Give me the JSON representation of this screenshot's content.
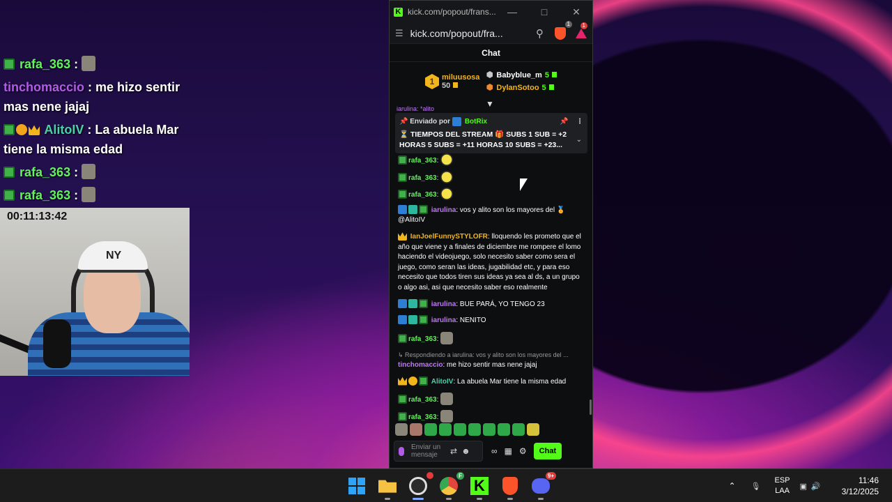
{
  "overlay_chat": [
    {
      "user": "rafa_363",
      "text": ":",
      "badges": [
        "green"
      ],
      "emote": true,
      "user_color": "green"
    },
    {
      "user": "tinchomaccio",
      "text": ": me hizo sentir mas nene jajaj",
      "badges": [],
      "emote": false,
      "user_color": "purple"
    },
    {
      "user": "AlitoIV",
      "text": ": La abuela Mar tiene la misma edad",
      "badges": [
        "green",
        "coin",
        "crown"
      ],
      "emote": false,
      "user_color": "teal"
    },
    {
      "user": "rafa_363",
      "text": ":",
      "badges": [
        "green"
      ],
      "emote": true,
      "user_color": "green"
    },
    {
      "user": "rafa_363",
      "text": ":",
      "badges": [
        "green"
      ],
      "emote": true,
      "user_color": "green"
    }
  ],
  "webcam": {
    "timer": "00:11:13:42",
    "cap_text": "NY"
  },
  "browser": {
    "title": "kick.com/popout/frans...",
    "url": "kick.com/popout/fra...",
    "brave_badge": "1",
    "alert_badge": "1",
    "logo_letter": "K"
  },
  "chat": {
    "header": "Chat",
    "leaderboard": {
      "first": {
        "rank": "1",
        "name": "miluusosa",
        "count": "50"
      },
      "others": [
        {
          "name": "Babyblue_m",
          "count": "5"
        },
        {
          "name": "DylanSotoo",
          "count": "5"
        }
      ]
    },
    "pinned": {
      "prefix": "Enviado por",
      "author": "BotRix",
      "text": "⏳ TIEMPOS DEL STREAM 🎁 SUBS 1 SUB = +2 HORAS 5 SUBS = +11 HORAS 10 SUBS = +23..."
    },
    "partial_top": "iarulina: *alito",
    "messages": [
      {
        "user": "rafa_363",
        "text": "",
        "emote": "yellow",
        "color": "green"
      },
      {
        "user": "rafa_363",
        "text": "",
        "emote": "yellow",
        "color": "green"
      },
      {
        "user": "rafa_363",
        "text": "",
        "emote": "yellow",
        "color": "green"
      },
      {
        "user": "iarulina",
        "text": "vos y alito son los mayores del 🏅 @AlitoIV",
        "color": "purple"
      },
      {
        "user": "IanJoelFunnySTYLOFR",
        "text": "lloquendo les prometo que el año que viene y a finales de diciembre me rompere el lomo haciendo el videojuego, solo necesito saber como sera el juego, como seran las ideas, jugabilidad etc, y para eso necesito que todos tiren sus ideas ya sea al ds, a un grupo o algo asi, asi que necesito saber eso realmente",
        "color": "orange"
      },
      {
        "user": "iarulina",
        "text": "BUE PARÁ, YO TENGO 23",
        "color": "purple"
      },
      {
        "user": "iarulina",
        "text": "NENITO",
        "color": "purple"
      },
      {
        "user": "rafa_363",
        "text": "",
        "emote": "cat",
        "color": "green"
      },
      {
        "reply": "↳ Respondiendo a iarulina: vos y alito son los mayores del ...",
        "user": "tinchomaccio",
        "text": "me hizo sentir mas nene jajaj",
        "color": "purple"
      },
      {
        "user": "AlitoIV",
        "text": "La abuela Mar tiene la misma edad",
        "color": "teal"
      },
      {
        "user": "rafa_363",
        "text": "",
        "emote": "cat",
        "color": "green"
      },
      {
        "user": "rafa_363",
        "text": "",
        "emote": "cat",
        "color": "green"
      }
    ],
    "input_placeholder": "Enviar un mensaje",
    "send_label": "Chat"
  },
  "taskbar": {
    "obs_badge": "",
    "chrome_badge": "F",
    "discord_badge": "9+",
    "lang_top": "ESP",
    "lang_bottom": "LAA",
    "time": "11:46",
    "date": "3/12/2025"
  }
}
